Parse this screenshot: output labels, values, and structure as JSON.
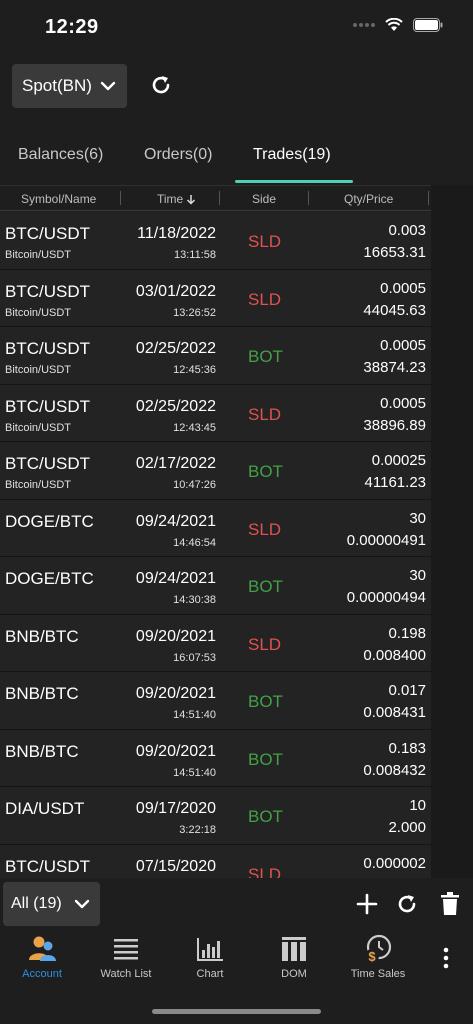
{
  "status": {
    "time": "12:29"
  },
  "market": {
    "selected": "Spot(BN)"
  },
  "tabs": [
    {
      "label": "Balances(6)"
    },
    {
      "label": "Orders(0)"
    },
    {
      "label": "Trades(19)"
    }
  ],
  "columns": {
    "symbol": "Symbol/Name",
    "time": "Time",
    "side": "Side",
    "qty": "Qty/Price"
  },
  "trades": [
    {
      "symbol": "BTC/USDT",
      "name": "Bitcoin/USDT",
      "date": "11/18/2022",
      "time": "13:11:58",
      "side": "SLD",
      "qty": "0.003",
      "price": "16653.31"
    },
    {
      "symbol": "BTC/USDT",
      "name": "Bitcoin/USDT",
      "date": "03/01/2022",
      "time": "13:26:52",
      "side": "SLD",
      "qty": "0.0005",
      "price": "44045.63"
    },
    {
      "symbol": "BTC/USDT",
      "name": "Bitcoin/USDT",
      "date": "02/25/2022",
      "time": "12:45:36",
      "side": "BOT",
      "qty": "0.0005",
      "price": "38874.23"
    },
    {
      "symbol": "BTC/USDT",
      "name": "Bitcoin/USDT",
      "date": "02/25/2022",
      "time": "12:43:45",
      "side": "SLD",
      "qty": "0.0005",
      "price": "38896.89"
    },
    {
      "symbol": "BTC/USDT",
      "name": "Bitcoin/USDT",
      "date": "02/17/2022",
      "time": "10:47:26",
      "side": "BOT",
      "qty": "0.00025",
      "price": "41161.23"
    },
    {
      "symbol": "DOGE/BTC",
      "name": "",
      "date": "09/24/2021",
      "time": "14:46:54",
      "side": "SLD",
      "qty": "30",
      "price": "0.00000491"
    },
    {
      "symbol": "DOGE/BTC",
      "name": "",
      "date": "09/24/2021",
      "time": "14:30:38",
      "side": "BOT",
      "qty": "30",
      "price": "0.00000494"
    },
    {
      "symbol": "BNB/BTC",
      "name": "",
      "date": "09/20/2021",
      "time": "16:07:53",
      "side": "SLD",
      "qty": "0.198",
      "price": "0.008400"
    },
    {
      "symbol": "BNB/BTC",
      "name": "",
      "date": "09/20/2021",
      "time": "14:51:40",
      "side": "BOT",
      "qty": "0.017",
      "price": "0.008431"
    },
    {
      "symbol": "BNB/BTC",
      "name": "",
      "date": "09/20/2021",
      "time": "14:51:40",
      "side": "BOT",
      "qty": "0.183",
      "price": "0.008432"
    },
    {
      "symbol": "DIA/USDT",
      "name": "",
      "date": "09/17/2020",
      "time": "3:22:18",
      "side": "BOT",
      "qty": "10",
      "price": "2.000"
    },
    {
      "symbol": "BTC/USDT",
      "name": "",
      "date": "07/15/2020",
      "time": "",
      "side": "SLD",
      "qty": "0.000002",
      "price": ""
    }
  ],
  "filter": {
    "selected": "All (19)"
  },
  "nav": [
    {
      "label": "Account",
      "icon": "account-icon"
    },
    {
      "label": "Watch List",
      "icon": "watch-list-icon"
    },
    {
      "label": "Chart",
      "icon": "chart-icon"
    },
    {
      "label": "DOM",
      "icon": "dom-icon"
    },
    {
      "label": "Time Sales",
      "icon": "time-sales-icon"
    }
  ],
  "colors": {
    "accent": "#4fd1b5",
    "sold": "#e0524f",
    "bought": "#43a047",
    "nav_active": "#2f8fe0"
  }
}
